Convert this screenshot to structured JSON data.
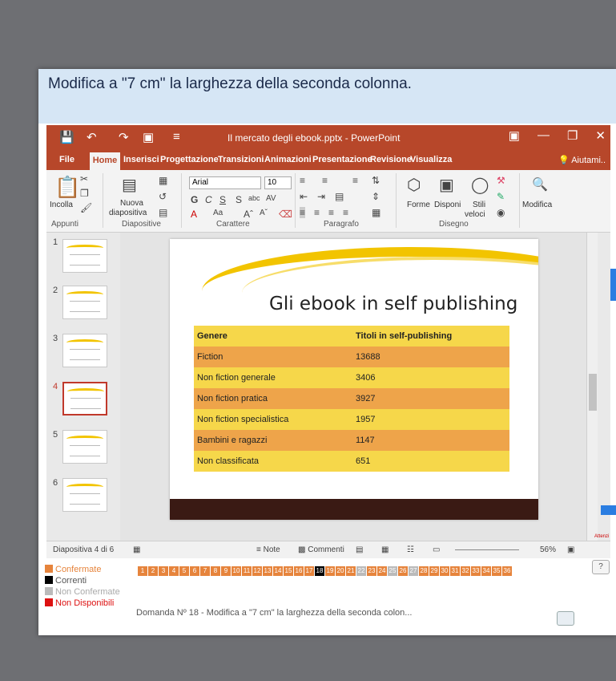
{
  "instruction": "Modifica a \"7 cm\" la larghezza della seconda colonna.",
  "ppt": {
    "title": "Il mercato degli ebook.pptx - PowerPoint",
    "tabs": [
      "File",
      "Home",
      "Inserisci",
      "Progettazione",
      "Transizioni",
      "Animazioni",
      "Presentazione",
      "Revisione",
      "Visualizza"
    ],
    "help": "Aiutami..",
    "ribbon": {
      "paste": "Incolla",
      "new_slide_1": "Nuova",
      "new_slide_2": "diapositiva",
      "font_name": "Arial",
      "font_size": "10",
      "shapes": "Forme",
      "arrange": "Disponi",
      "quick_styles_1": "Stili",
      "quick_styles_2": "veloci",
      "edit": "Modifica",
      "groups": [
        "Appunti",
        "Diapositive",
        "Carattere",
        "Paragrafo",
        "Disegno"
      ]
    },
    "thumbnails": [
      "1",
      "2",
      "3",
      "4",
      "5",
      "6"
    ],
    "slide": {
      "title": "Gli ebook in self publishing",
      "headers": [
        "Genere",
        "Titoli in self-publishing"
      ],
      "rows": [
        [
          "Fiction",
          "13688"
        ],
        [
          "Non fiction generale",
          "3406"
        ],
        [
          "Non fiction pratica",
          "3927"
        ],
        [
          "Non fiction specialistica",
          "1957"
        ],
        [
          "Bambini e ragazzi",
          "1147"
        ],
        [
          "Non classificata",
          "651"
        ]
      ]
    },
    "status": {
      "slide_count": "Diapositiva 4 di 6",
      "notes": "Note",
      "comments": "Commenti",
      "zoom": "56%"
    }
  },
  "legend": {
    "confirmed": "Confermate",
    "current": "Correnti",
    "unconfirmed": "Non Confermate",
    "unavailable": "Non Disponibili"
  },
  "questions": [
    "1",
    "2",
    "3",
    "4",
    "5",
    "6",
    "7",
    "8",
    "9",
    "10",
    "11",
    "12",
    "13",
    "14",
    "15",
    "16",
    "17",
    "18",
    "19",
    "20",
    "21",
    "22",
    "23",
    "24",
    "25",
    "26",
    "27",
    "28",
    "29",
    "30",
    "31",
    "32",
    "33",
    "34",
    "35",
    "36"
  ],
  "current_question": "18",
  "question_text": "Domanda Nº 18 - Modifica a \"7 cm\" la larghezza della seconda colon...",
  "right_edge": {
    "attention": "Attenzi"
  },
  "colors": {
    "ppt_accent": "#b7472a",
    "table_orange": "#eea44a",
    "table_yellow": "#f6d74a",
    "confirmed": "#e6843c",
    "current": "#000000",
    "unconfirmed": "#bbbbbb",
    "unavailable": "#dd1111"
  }
}
